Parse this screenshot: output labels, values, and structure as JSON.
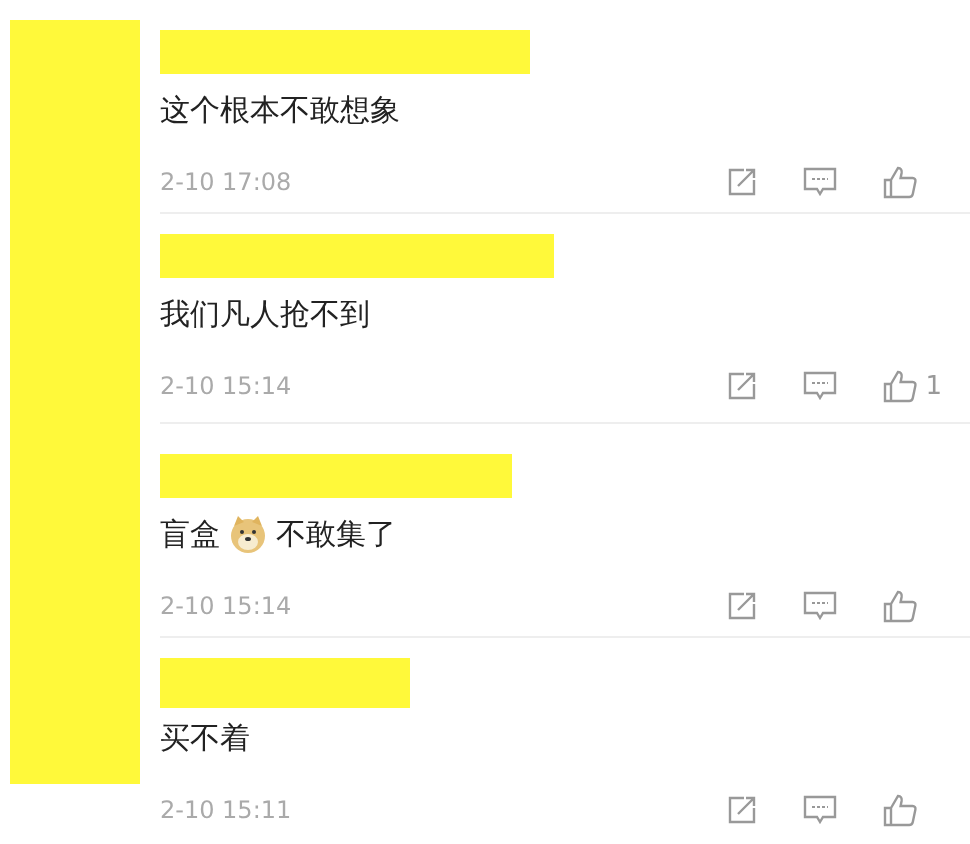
{
  "sidebar": {
    "redacted": true
  },
  "comments": [
    {
      "name_redacted": true,
      "content": [
        {
          "kind": "text",
          "text": "这个根本不敢想象"
        }
      ],
      "time": "2-10 17:08"
    },
    {
      "name_redacted": true,
      "content": [
        {
          "kind": "text",
          "text": "我们凡人抢不到"
        }
      ],
      "time": "2-10 15:14",
      "likes": "1"
    },
    {
      "name_redacted": true,
      "content": [
        {
          "kind": "text",
          "text": "盲盒"
        },
        {
          "kind": "emoji"
        },
        {
          "kind": "text",
          "text": "不敢集了"
        }
      ],
      "time": "2-10 15:14"
    },
    {
      "name_redacted": true,
      "content": [
        {
          "kind": "text",
          "text": "买不着"
        }
      ],
      "time": "2-10 15:11"
    }
  ]
}
